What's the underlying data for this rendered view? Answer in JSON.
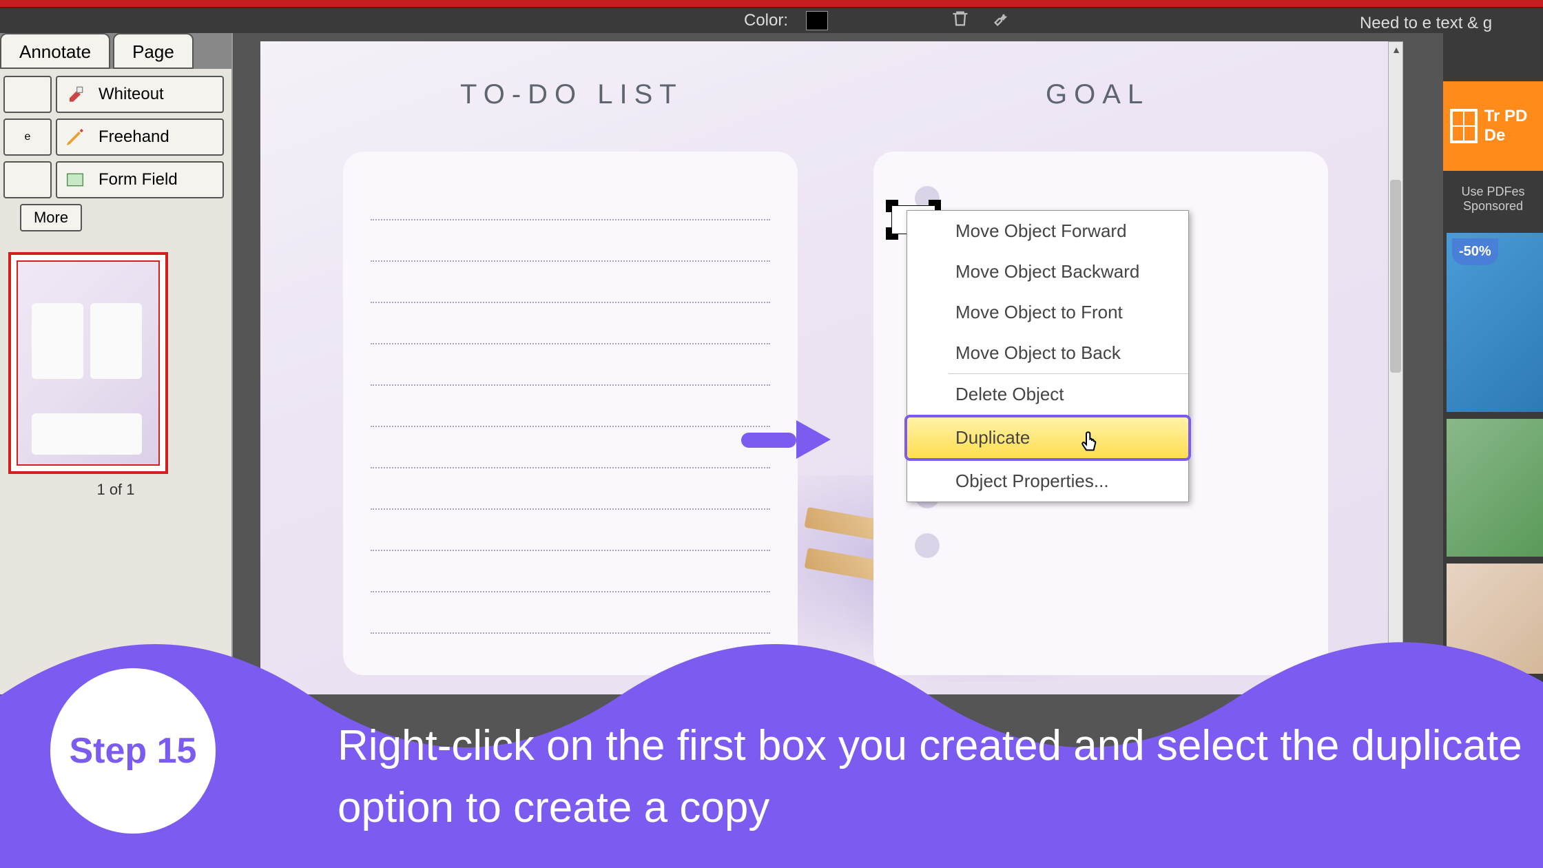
{
  "toolbar": {
    "color_label": "Color:",
    "need_text": "Need to e text & g"
  },
  "tabs": {
    "annotate": "Annotate",
    "page": "Page"
  },
  "tools": {
    "whiteout": "Whiteout",
    "freehand": "Freehand",
    "form_field": "Form Field",
    "more": "More"
  },
  "thumbnail": {
    "counter": "1 of 1"
  },
  "document": {
    "todo_title": "TO-DO LIST",
    "goal_title": "GOAL"
  },
  "context_menu": {
    "items": [
      "Move Object Forward",
      "Move Object Backward",
      "Move Object to Front",
      "Move Object to Back",
      "Delete Object",
      "Duplicate",
      "Object Properties..."
    ]
  },
  "promo": {
    "try_text": "Tr PD De",
    "sub_text": "Use PDFes Sponsored"
  },
  "discount": "-50%",
  "step": {
    "label": "Step 15",
    "text": "Right-click on the first box you created and select the duplicate option to create a copy"
  }
}
